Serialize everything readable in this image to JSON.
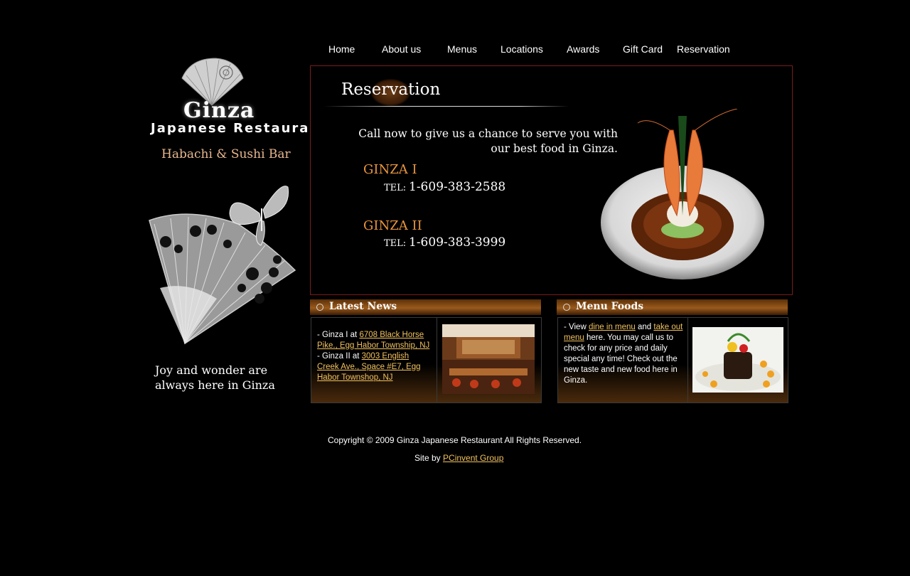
{
  "nav": {
    "items": [
      "Home",
      "About us",
      "Menus",
      "Locations",
      "Awards",
      "Gift Card",
      "Reservation"
    ]
  },
  "logo": {
    "name": "Ginza",
    "subtitle": "Japanese Restaurant"
  },
  "sidebar": {
    "tagline": "Habachi & Sushi Bar",
    "motto": "Joy and wonder are always here in Ginza"
  },
  "reservation": {
    "title": "Reservation",
    "call_text": "Call now to give us a chance to serve you with our best food in Ginza.",
    "locations": [
      {
        "name": "GINZA I",
        "tel_label": "TEL:",
        "tel": "1-609-383-2588"
      },
      {
        "name": "GINZA II",
        "tel_label": "TEL:",
        "tel": "1-609-383-3999"
      }
    ]
  },
  "news": {
    "title": "Latest News",
    "item1_prefix": "- Ginza I at ",
    "item1_link": "6708 Black Horse Pike., Egg Habor Township, NJ",
    "item2_prefix": "- Ginza II at ",
    "item2_link": "3003 English Creek Ave., Space #E7, Egg Habor Townshop, NJ"
  },
  "menu_foods": {
    "title": "Menu Foods",
    "prefix": "- View ",
    "link_dine": "dine in menu",
    "and": " and ",
    "link_takeout": "take out menu",
    "suffix": " here. You may call us to check for any price and daily special any time! Check out the new taste and new food here in Ginza."
  },
  "footer": {
    "copyright": "Copyright © 2009 Ginza Japanese Restaurant  All Rights Reserved.",
    "siteby_prefix": "Site by ",
    "siteby_link": "PCinvent Group"
  },
  "colors": {
    "background": "#000000",
    "accent_orange": "#e8943c",
    "link": "#f0c060",
    "border_red": "#7a1c1c"
  }
}
